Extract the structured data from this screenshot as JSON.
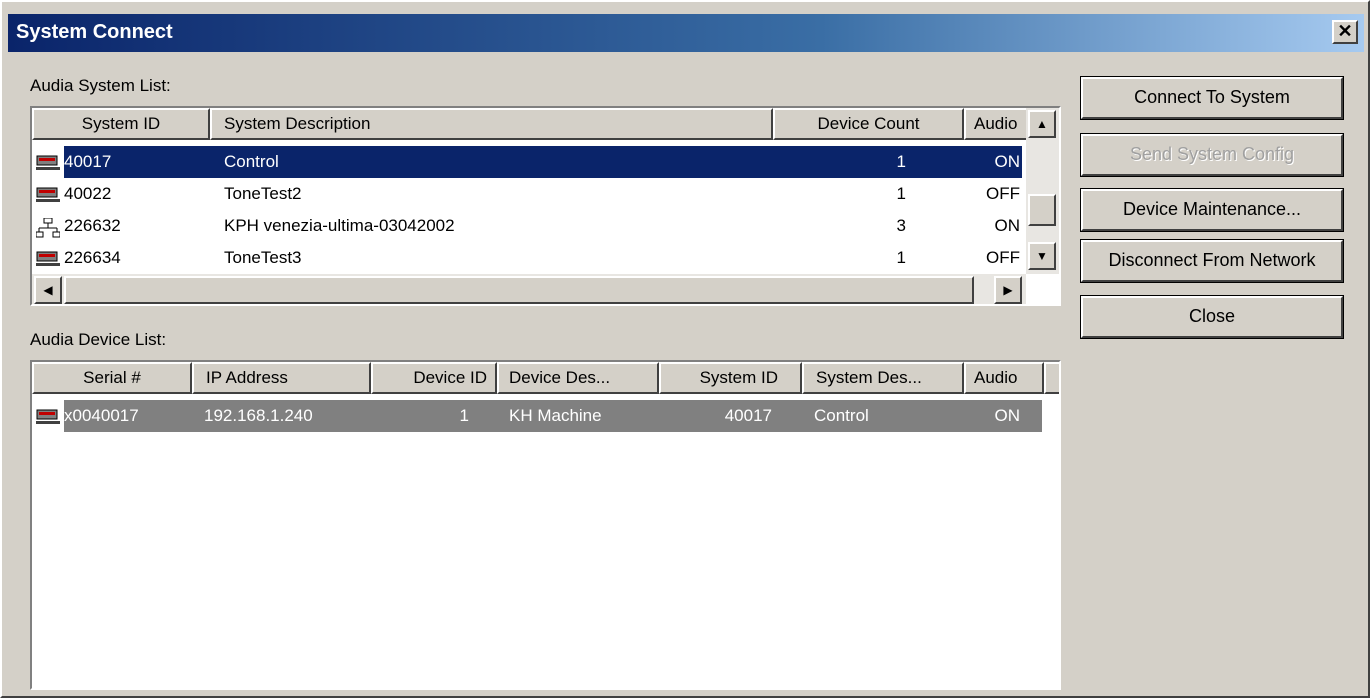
{
  "window": {
    "title": "System Connect",
    "close_glyph": "✕"
  },
  "system_list": {
    "label": "Audia System List:",
    "columns": [
      "System ID",
      "System Description",
      "Device Count",
      "Audio"
    ],
    "rows": [
      {
        "icon": "device-icon",
        "id": "40017",
        "desc": "Control",
        "count": "1",
        "audio": "ON",
        "selected": true
      },
      {
        "icon": "device-icon",
        "id": "40022",
        "desc": "ToneTest2",
        "count": "1",
        "audio": "OFF",
        "selected": false
      },
      {
        "icon": "network-icon",
        "id": "226632",
        "desc": "KPH venezia-ultima-03042002",
        "count": "3",
        "audio": "ON",
        "selected": false
      },
      {
        "icon": "device-icon",
        "id": "226634",
        "desc": "ToneTest3",
        "count": "1",
        "audio": "OFF",
        "selected": false
      }
    ]
  },
  "device_list": {
    "label": "Audia Device List:",
    "columns": [
      "Serial #",
      "IP Address",
      "Device ID",
      "Device Des...",
      "System ID",
      "System Des...",
      "Audio"
    ],
    "rows": [
      {
        "icon": "device-icon",
        "serial": "x0040017",
        "ip": "192.168.1.240",
        "device_id": "1",
        "device_desc": "KH Machine",
        "system_id": "40017",
        "system_desc": "Control",
        "audio": "ON"
      }
    ]
  },
  "buttons": {
    "connect": "Connect To System",
    "send_config": "Send System Config",
    "maintenance": "Device Maintenance...",
    "disconnect": "Disconnect From Network",
    "close": "Close"
  },
  "colors": {
    "selection": "#0a246a",
    "inactive_selection": "#808080",
    "face": "#d4d0c8"
  }
}
